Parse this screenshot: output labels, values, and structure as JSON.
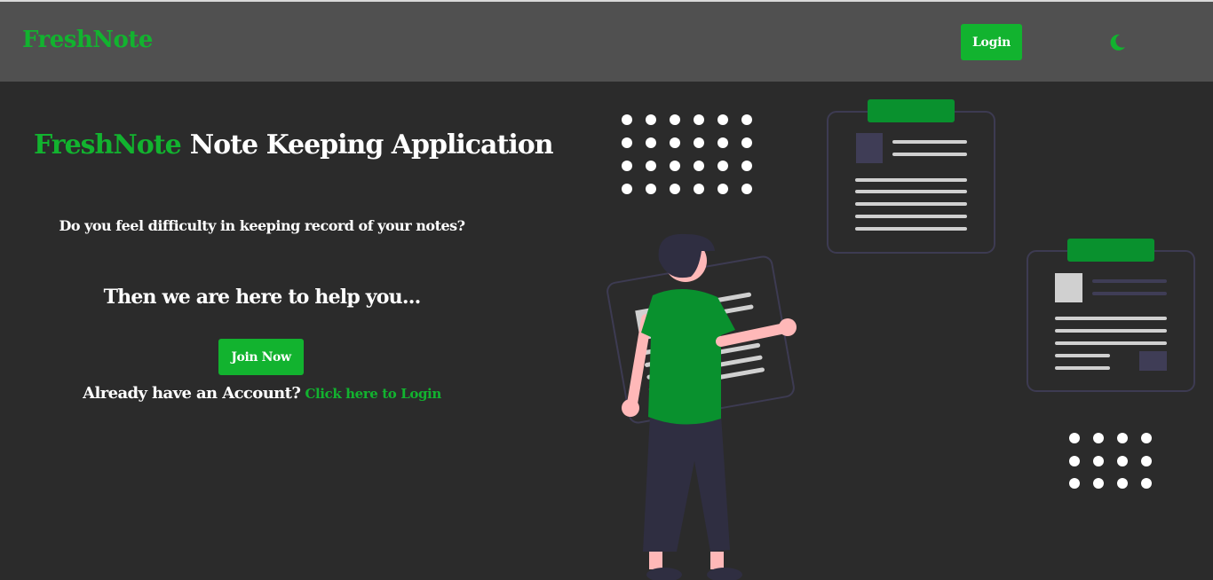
{
  "navbar": {
    "brand": "FreshNote",
    "login_label": "Login",
    "theme_icon": "moon-icon"
  },
  "hero": {
    "brand": "FreshNote",
    "title": "Note Keeping Application",
    "question": "Do you feel difficulty in keeping record of your notes?",
    "help": "Then we are here to help you...",
    "join_label": "Join Now",
    "account_text": "Already have an Account?",
    "login_link": "Click here to Login"
  },
  "colors": {
    "accent": "#12b32f",
    "navbar_bg": "#505050",
    "page_bg": "#2b2b2b"
  }
}
